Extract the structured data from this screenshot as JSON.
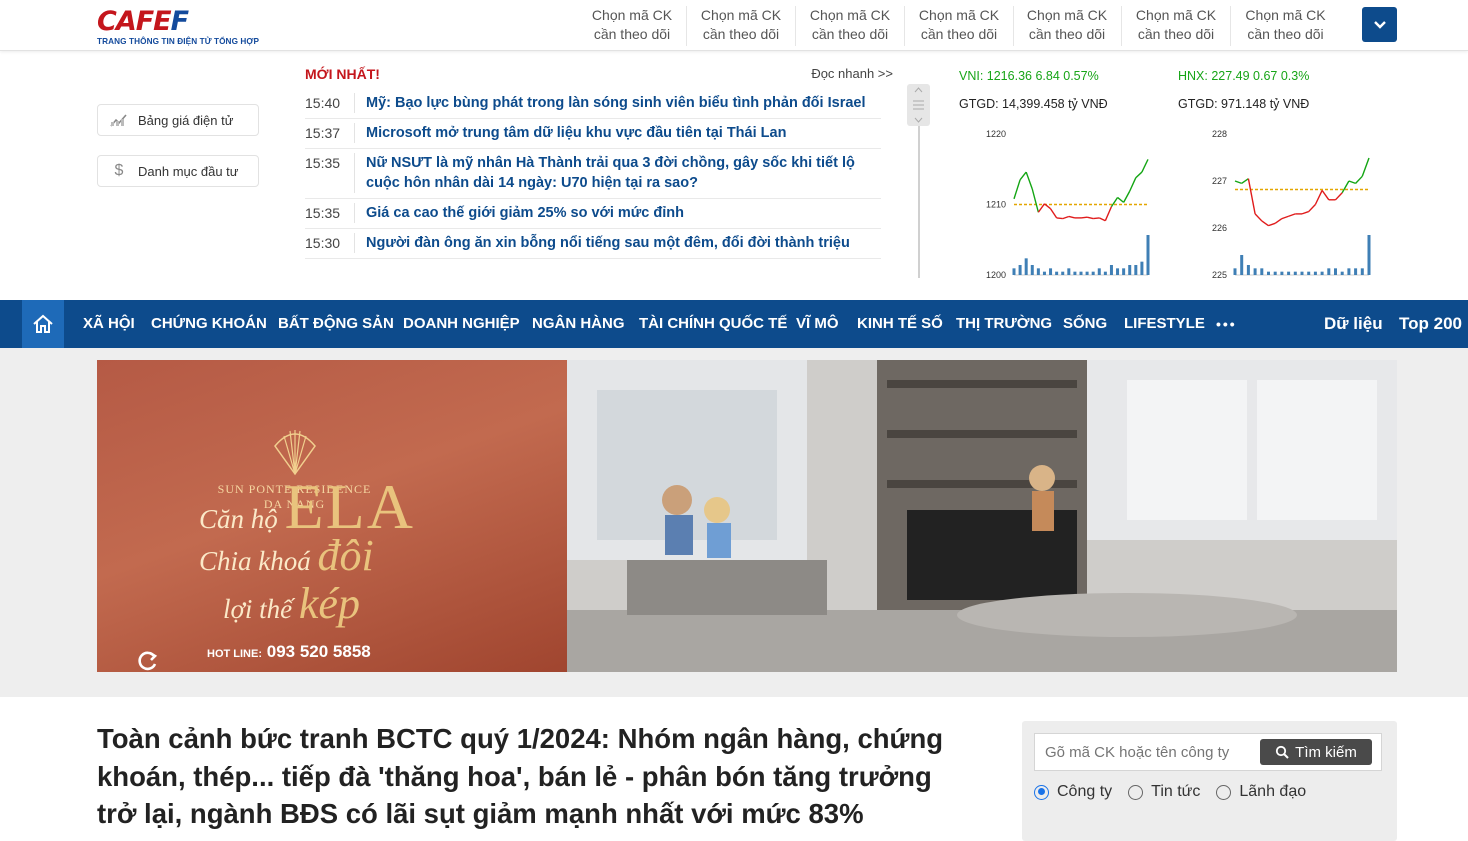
{
  "header": {
    "logo_part1": "CAFE",
    "logo_part2": "F",
    "logo_tagline": "TRANG THÔNG TIN ĐIỆN TỬ TỔNG HỢP",
    "watch_slots": [
      {
        "line1": "Chọn mã CK",
        "line2": "cần theo dõi"
      },
      {
        "line1": "Chọn mã CK",
        "line2": "cần theo dõi"
      },
      {
        "line1": "Chọn mã CK",
        "line2": "cần theo dõi"
      },
      {
        "line1": "Chọn mã CK",
        "line2": "cần theo dõi"
      },
      {
        "line1": "Chọn mã CK",
        "line2": "cần theo dõi"
      },
      {
        "line1": "Chọn mã CK",
        "line2": "cần theo dõi"
      },
      {
        "line1": "Chọn mã CK",
        "line2": "cần theo dõi"
      }
    ],
    "expand_icon": "chevron-down-icon"
  },
  "sidebar": {
    "price_board": "Bảng giá điện tử",
    "portfolio": "Danh mục đầu tư"
  },
  "feed": {
    "title": "MỚI NHẤT!",
    "more": "Đọc nhanh >>",
    "items": [
      {
        "time": "15:40",
        "text": "Mỹ: Bạo lực bùng phát trong làn sóng sinh viên biểu tình phản đối Israel"
      },
      {
        "time": "15:37",
        "text": "Microsoft mở trung tâm dữ liệu khu vực đầu tiên tại Thái Lan"
      },
      {
        "time": "15:35",
        "text": "Nữ NSƯT là mỹ nhân Hà Thành trải qua 3 đời chồng, gây sốc khi tiết lộ cuộc hôn nhân dài 14 ngày: U70 hiện tại ra sao?"
      },
      {
        "time": "15:35",
        "text": "Giá ca cao thế giới giảm 25% so với mức đỉnh"
      },
      {
        "time": "15:30",
        "text": "Người đàn ông ăn xin bỗng nổi tiếng sau một đêm, đổi đời thành triệu"
      }
    ]
  },
  "indices": [
    {
      "label": "VNI: 1216.36 6.84 0.57%",
      "gtgd": "GTGD: 14,399.458 tỷ VNĐ"
    },
    {
      "label": "HNX: 227.49 0.67 0.3%",
      "gtgd": "GTGD: 971.148 tỷ VNĐ"
    }
  ],
  "chart_data": [
    {
      "type": "line",
      "title": "VNI",
      "yticks": [
        "1220",
        "1210",
        "1200"
      ],
      "ylim": [
        1200,
        1220
      ],
      "reference": 1210,
      "y": [
        1210.8,
        1213.5,
        1214.6,
        1212.2,
        1208.9,
        1210.1,
        1209.4,
        1208.1,
        1208.0,
        1208.3,
        1208.1,
        1208.1,
        1208.2,
        1208.0,
        1208.1,
        1207.7,
        1209.7,
        1211.0,
        1210.3,
        1211.9,
        1213.8,
        1214.6,
        1216.4
      ],
      "volume": [
        2,
        3,
        5,
        3,
        2,
        1,
        2,
        1,
        1,
        2,
        1,
        1,
        1,
        1,
        2,
        1,
        3,
        2,
        2,
        3,
        3,
        4,
        12
      ]
    },
    {
      "type": "line",
      "title": "HNX",
      "yticks": [
        "228",
        "227",
        "226",
        "225"
      ],
      "ylim": [
        225,
        228
      ],
      "reference": 226.82,
      "y": [
        227.0,
        226.95,
        227.05,
        226.3,
        226.15,
        226.05,
        226.1,
        226.2,
        226.25,
        226.3,
        226.3,
        226.35,
        226.5,
        226.8,
        226.6,
        226.6,
        226.75,
        227.0,
        226.95,
        227.1,
        227.49
      ],
      "volume": [
        2,
        6,
        3,
        2,
        2,
        1,
        1,
        1,
        1,
        1,
        1,
        1,
        1,
        1,
        2,
        2,
        1,
        2,
        2,
        2,
        12
      ]
    }
  ],
  "nav": {
    "home_icon": "home-icon",
    "items": [
      "XÃ HỘI",
      "CHỨNG KHOÁN",
      "BẤT ĐỘNG SẢN",
      "DOANH NGHIỆP",
      "NGÂN HÀNG",
      "TÀI CHÍNH QUỐC TẾ",
      "VĨ MÔ",
      "KINH TẾ SỐ",
      "THỊ TRƯỜNG",
      "SỐNG",
      "LIFESTYLE"
    ],
    "more": "•••",
    "right": [
      "Dữ liệu",
      "Top 200"
    ]
  },
  "ad": {
    "brand1": "SUN PONTE RESIDENCE",
    "brand2": "DA NANG",
    "line1_a": "Căn hộ ",
    "line1_b": "ELA",
    "line2_a": "Chia khoá ",
    "line2_b": "đôi",
    "line3_a": "lợi thế ",
    "line3_b": "kép",
    "hotline_label": "HOT LINE:",
    "hotline": "093 520 5858"
  },
  "article": {
    "headline": "Toàn cảnh bức tranh BCTC quý 1/2024: Nhóm ngân hàng, chứng khoán, thép... tiếp đà 'thăng hoa', bán lẻ - phân bón tăng trưởng trở lại, ngành BĐS có lãi sụt giảm mạnh nhất với mức 83%"
  },
  "search": {
    "placeholder": "Gõ mã CK hoặc tên công ty",
    "button": "Tìm kiếm",
    "options": [
      "Công ty",
      "Tin tức",
      "Lãnh đạo"
    ],
    "selected": "Công ty"
  }
}
